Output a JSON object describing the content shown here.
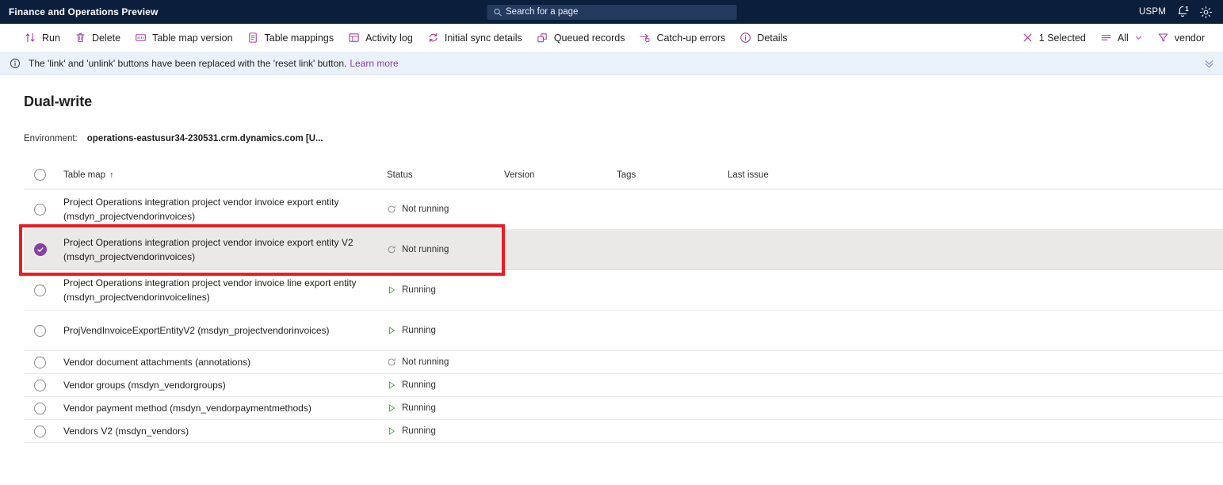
{
  "topbar": {
    "app_title": "Finance and Operations Preview",
    "search_placeholder": "Search for a page",
    "search_icon": "search-icon",
    "user_initials": "USPM",
    "notification_count": "1",
    "notification_icon": "bell-icon",
    "settings_icon": "gear-icon"
  },
  "commandbar": {
    "items": [
      {
        "label": "Run",
        "icon": "run-arrows-icon"
      },
      {
        "label": "Delete",
        "icon": "trash-icon"
      },
      {
        "label": "Table map version",
        "icon": "table-map-version-icon"
      },
      {
        "label": "Table mappings",
        "icon": "table-mappings-icon"
      },
      {
        "label": "Activity log",
        "icon": "activity-log-icon"
      },
      {
        "label": "Initial sync details",
        "icon": "sync-refresh-icon"
      },
      {
        "label": "Queued records",
        "icon": "queued-records-icon"
      },
      {
        "label": "Catch-up errors",
        "icon": "catch-up-errors-icon"
      },
      {
        "label": "Details",
        "icon": "info-circle-icon"
      }
    ],
    "right_items": [
      {
        "label": "1 Selected",
        "icon": "close-x-icon"
      },
      {
        "label": "All",
        "icon": "filter-list-icon",
        "trailing_icon": "chevron-down-icon"
      },
      {
        "label": "vendor",
        "icon": "funnel-filter-icon"
      }
    ]
  },
  "messagebar": {
    "icon": "info-circle-icon",
    "text": "The 'link' and 'unlink' buttons have been replaced with the 'reset link' button.",
    "link_text": "Learn more",
    "collapse_icon": "double-chevron-down-icon",
    "background": "#e9f1fb"
  },
  "page": {
    "title": "Dual-write",
    "environment_label": "Environment:",
    "environment_value": "operations-eastusur34-230531.crm.dynamics.com [U..."
  },
  "grid": {
    "columns": [
      {
        "key": "map",
        "label": "Table map",
        "sorted": "asc",
        "sort_glyph": "↑"
      },
      {
        "key": "status",
        "label": "Status"
      },
      {
        "key": "version",
        "label": "Version"
      },
      {
        "key": "tags",
        "label": "Tags"
      },
      {
        "key": "issue",
        "label": "Last issue"
      }
    ],
    "rows": [
      {
        "name": "Project Operations integration project vendor invoice export entity (msdyn_projectvendorinvoices)",
        "status": "Not running",
        "status_icon": "not-running-icon",
        "version": "",
        "tags": "",
        "last_issue": "",
        "selected": false,
        "tall": true
      },
      {
        "name": "Project Operations integration project vendor invoice export entity V2 (msdyn_projectvendorinvoices)",
        "status": "Not running",
        "status_icon": "not-running-icon",
        "version": "",
        "tags": "",
        "last_issue": "",
        "selected": true,
        "tall": true
      },
      {
        "name": "Project Operations integration project vendor invoice line export entity (msdyn_projectvendorinvoicelines)",
        "status": "Running",
        "status_icon": "running-icon",
        "version": "",
        "tags": "",
        "last_issue": "",
        "selected": false,
        "tall": true
      },
      {
        "name": "ProjVendInvoiceExportEntityV2 (msdyn_projectvendorinvoices)",
        "status": "Running",
        "status_icon": "running-icon",
        "version": "",
        "tags": "",
        "last_issue": "",
        "selected": false,
        "tall": true
      },
      {
        "name": "Vendor document attachments (annotations)",
        "status": "Not running",
        "status_icon": "not-running-icon",
        "version": "",
        "tags": "",
        "last_issue": "",
        "selected": false,
        "tall": false
      },
      {
        "name": "Vendor groups (msdyn_vendorgroups)",
        "status": "Running",
        "status_icon": "running-icon",
        "version": "",
        "tags": "",
        "last_issue": "",
        "selected": false,
        "tall": false
      },
      {
        "name": "Vendor payment method (msdyn_vendorpaymentmethods)",
        "status": "Running",
        "status_icon": "running-icon",
        "version": "",
        "tags": "",
        "last_issue": "",
        "selected": false,
        "tall": false
      },
      {
        "name": "Vendors V2 (msdyn_vendors)",
        "status": "Running",
        "status_icon": "running-icon",
        "version": "",
        "tags": "",
        "last_issue": "",
        "selected": false,
        "tall": false
      }
    ]
  },
  "colors": {
    "navbar": "#0b1f3d",
    "accent_purple": "#8a3fa0",
    "running_green": "#4f9b4f",
    "annotation_red": "#ec1c24",
    "selected_row": "#eae9e8"
  }
}
